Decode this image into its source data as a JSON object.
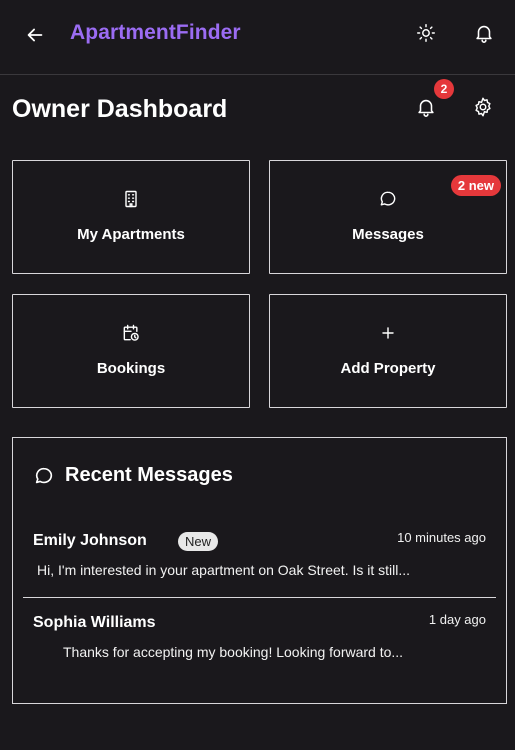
{
  "app": {
    "brand": "ApartmentFinder"
  },
  "header": {
    "title": "Owner Dashboard",
    "notification_count": "2"
  },
  "tiles": [
    {
      "label": "My Apartments",
      "icon": "building-icon"
    },
    {
      "label": "Messages",
      "icon": "chat-bubble-icon",
      "badge": "2 new"
    },
    {
      "label": "Bookings",
      "icon": "calendar-clock-icon"
    },
    {
      "label": "Add Property",
      "icon": "plus-icon"
    }
  ],
  "recent": {
    "title": "Recent Messages",
    "messages": [
      {
        "sender": "Emily Johnson",
        "tag": "New",
        "time": "10 minutes ago",
        "preview": "Hi, I'm interested in your apartment on Oak Street. Is it still..."
      },
      {
        "sender": "Sophia Williams",
        "time": "1 day ago",
        "preview": "Thanks for accepting my booking! Looking forward to..."
      }
    ]
  },
  "colors": {
    "background": "#1a181c",
    "brand": "#9b6cf3",
    "badge": "#e5383b",
    "border": "#d8d6da"
  }
}
